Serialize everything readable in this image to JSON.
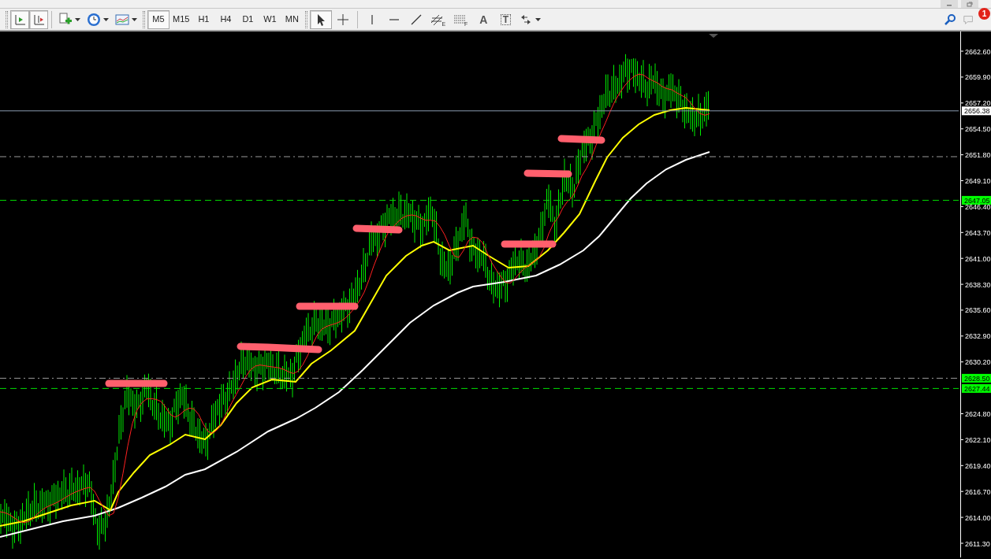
{
  "toolbar": {
    "chart_buttons": [
      {
        "kind": "autoscroll",
        "selected": true
      },
      {
        "kind": "shift",
        "selected": true
      }
    ],
    "timeframes": [
      {
        "label": "M5",
        "selected": true
      },
      {
        "label": "M15",
        "selected": false
      },
      {
        "label": "H1",
        "selected": false
      },
      {
        "label": "H4",
        "selected": false
      },
      {
        "label": "D1",
        "selected": false
      },
      {
        "label": "W1",
        "selected": false
      },
      {
        "label": "MN",
        "selected": false
      }
    ],
    "tools": [
      {
        "kind": "cursor",
        "selected": true
      },
      {
        "kind": "crosshair",
        "selected": false
      },
      {
        "kind": "vline",
        "selected": false
      },
      {
        "kind": "hline",
        "selected": false
      },
      {
        "kind": "trendline",
        "selected": false
      },
      {
        "kind": "channel",
        "mark": "E",
        "selected": false
      },
      {
        "kind": "fibo",
        "mark": "F",
        "selected": false
      },
      {
        "kind": "text",
        "mark": "A",
        "selected": false
      },
      {
        "kind": "label",
        "mark": "T",
        "selected": false
      },
      {
        "kind": "arrows",
        "selected": false
      }
    ],
    "notification_count": "1"
  },
  "price_axis": {
    "labels": [
      "2662.60",
      "2659.90",
      "2657.20",
      "2654.50",
      "2651.80",
      "2649.10",
      "2646.40",
      "2643.70",
      "2641.00",
      "2638.30",
      "2635.60",
      "2632.90",
      "2630.20",
      "2624.80",
      "2622.10",
      "2619.40",
      "2616.70",
      "2614.00",
      "2611.30"
    ],
    "tags": [
      {
        "text": "2656.38",
        "color": "#ffffff",
        "kind": "solid"
      },
      {
        "text": "2647.05",
        "color": "#00ff00",
        "kind": "dashed"
      },
      {
        "text": "2628.50",
        "color": "#00ff00",
        "kind": "dashdot"
      },
      {
        "text": "2627.44",
        "color": "#00ff00",
        "kind": "dashed"
      }
    ]
  }
}
